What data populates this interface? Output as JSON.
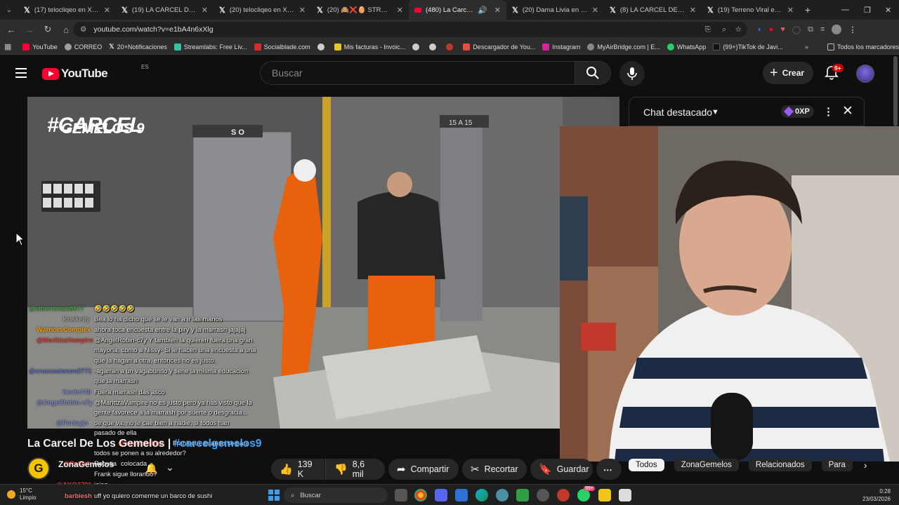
{
  "browser": {
    "tabs": [
      {
        "label": "(17) telocliqeo en X: \"❌ ❗❗",
        "icon": "x-logo"
      },
      {
        "label": "(19) LA CARCEL DE LOS GEMELOS",
        "icon": "x-logo"
      },
      {
        "label": "(20) telocliqeo en X: \"Mar...",
        "icon": "x-logo"
      },
      {
        "label": "(20) 🙈❌🥚 STRONG b...",
        "icon": "x-logo"
      },
      {
        "label": "(480) La Carcel De Los...",
        "icon": "youtube-icon",
        "active": true
      },
      {
        "label": "(20) Dama Livia en X: \"Pe...",
        "icon": "x-logo"
      },
      {
        "label": "(8) LA CARCEL DE LOS GE...",
        "icon": "x-logo"
      },
      {
        "label": "(19) Terreno Viral en X: \"...",
        "icon": "x-logo"
      }
    ],
    "url": "youtube.com/watch?v=e1bA4n6xXlg",
    "bookmarks": [
      {
        "label": "YouTube",
        "color": "#ff0033"
      },
      {
        "label": "CORREO",
        "color": "#9aa0a6"
      },
      {
        "label": "20+Notificaciones",
        "color": "#444444"
      },
      {
        "label": "Streamlabs: Free Liv...",
        "color": "#31c3a2"
      },
      {
        "label": "Socialblade.com",
        "color": "#d62d2d"
      },
      {
        "label": "",
        "color": "#cccccc"
      },
      {
        "label": "Mis facturas - Invoic...",
        "color": "#e7c62b"
      },
      {
        "label": "",
        "color": "#cccccc"
      },
      {
        "label": "",
        "color": "#cccccc"
      },
      {
        "label": "",
        "color": "#c0392b"
      },
      {
        "label": "Descargador de You...",
        "color": "#e74c3c"
      },
      {
        "label": "Instagram",
        "color": "#d6249f"
      },
      {
        "label": "MyAirBridge.com | E...",
        "color": "#888888"
      },
      {
        "label": "WhatsApp",
        "color": "#25d366"
      },
      {
        "label": "(99+)TikTok de Javi...",
        "color": "#111111"
      }
    ],
    "all_bookmarks": "Todos los marcadores"
  },
  "masthead": {
    "logo_text": "YouTube",
    "country_code": "ES",
    "search_placeholder": "Buscar",
    "create_label": "Crear",
    "notifications_badge": "9+"
  },
  "chat_panel": {
    "title": "Chat destacado",
    "xp_label": "0XP"
  },
  "video_overlay": {
    "watermark": "#CARCEL GEMELOS 9",
    "door_sign": "15 A 15"
  },
  "chat_messages": [
    {
      "user": "@albertoxale8577",
      "text": "🤣🤣🤣🤣🤣",
      "user_color": "#43a047"
    },
    {
      "user": "Kriskeily",
      "text": "Bea lo ha dicho que se le van a ir las manos",
      "user_color": "#9e9e9e"
    },
    {
      "user": "WarriorsComplex",
      "text": "ahora toca encuesta entre la piry y la marrash jajajaj",
      "user_color": "#ffa000"
    },
    {
      "user": "@MarittzaVampire",
      "text": "@AngelRobin-c7y Y tambien la quieren fuera una gran",
      "user_color": "#e53935"
    },
    {
      "user": "",
      "text": "mayoría, como a Nissy- Si le hacen una encuesta a una",
      "user_color": "#e53935"
    },
    {
      "user": "",
      "text": "que la hagan a otra, entonces no es justo.",
      "user_color": "#e53935"
    },
    {
      "user": "@cruzcastanon2771",
      "text": "-agarran a un vagabundo y tiene la misma educacion",
      "user_color": "#5c6bc0"
    },
    {
      "user": "",
      "text": "que la marrash",
      "user_color": "#5c6bc0"
    },
    {
      "user": "Kevin740",
      "text": "Fuera marrash das asco",
      "user_color": "#7986cb"
    },
    {
      "user": "@AngelRobin-c7y",
      "text": "@MarittzaVampire no es justo pero ya has visto que la",
      "user_color": "#7986cb"
    },
    {
      "user": "",
      "text": "gente favorece a la marrash por suerte o desgracia...",
      "user_color": "#7986cb"
    },
    {
      "user": "@Parisyjn",
      "text": "de que va, no le cae bien a nadie, si todos han",
      "user_color": "#7986cb"
    },
    {
      "user": "",
      "text": "pasado de ella",
      "user_color": "#7986cb"
    },
    {
      "user": "@jorgebasbbb",
      "text": "Frank que cuando se para",
      "user_color": "#e53935"
    },
    {
      "user": "",
      "text": "todos se ponen a su alrededor?",
      "user_color": "#e53935"
    },
    {
      "user": "@Ralbeh",
      "text": "Frank sigue llorando?",
      "user_color": "#e53935"
    },
    {
      "user": "@AKO3791",
      "text": "jajaa",
      "user_color": "#e53935"
    },
    {
      "user": "barbiesh",
      "text": "uff yo quiero comerme un barco de sushi",
      "user_color": "#e57373"
    }
  ],
  "chat_overlay_extra": {
    "rebutia": "Rebutia",
    "colocada": "colocada"
  },
  "video": {
    "title": "La Carcel De Los Gemelos | ",
    "hashtag": "#carcelgemelos9",
    "channel": "ZonaGemelos",
    "likes": "139 K",
    "dislikes": "8,6 mil",
    "share": "Compartir",
    "clip": "Recortar",
    "save": "Guardar"
  },
  "filter_chips": [
    "Todos",
    "ZonaGemelos",
    "Relacionados",
    "Para"
  ],
  "taskbar": {
    "temperature": "15°C",
    "weather": "Limpio",
    "search": "Buscar",
    "time": "0:28",
    "date": "23/03/2026",
    "whatsapp_badge": "99+"
  }
}
